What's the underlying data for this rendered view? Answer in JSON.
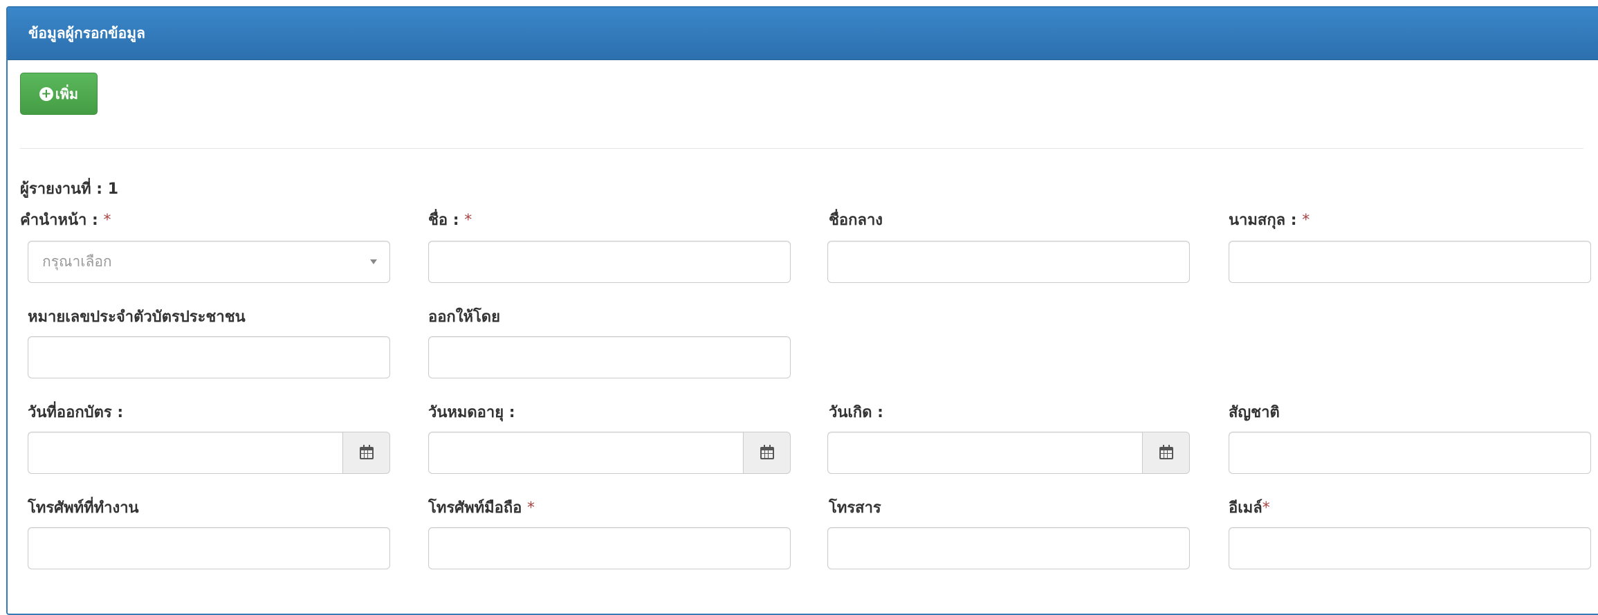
{
  "panel": {
    "title": "ข้อมูลผู้กรอกข้อมูล",
    "heading_color": "#337ab7"
  },
  "toolbar": {
    "add_label": "เพิ่ม",
    "add_icon": "plus-circle-icon",
    "add_color": "#5cb85c"
  },
  "reporter": {
    "section_label": "ผู้รายงานที่ : 1"
  },
  "form": {
    "title_prefix": {
      "label": "คำนำหน้า : ",
      "required": "*",
      "placeholder": "กรุณาเลือก"
    },
    "first_name": {
      "label": "ชื่อ : ",
      "required": "*",
      "value": ""
    },
    "middle_name": {
      "label": "ชื่อกลาง",
      "value": ""
    },
    "last_name": {
      "label": "นามสกุล : ",
      "required": "*",
      "value": ""
    },
    "id_card_number": {
      "label": "หมายเลขประจำตัวบัตรประชาชน",
      "value": ""
    },
    "issued_by": {
      "label": "ออกให้โดย",
      "value": ""
    },
    "issue_date": {
      "label": "วันที่ออกบัตร :",
      "value": ""
    },
    "expiry_date": {
      "label": "วันหมดอายุ :",
      "value": ""
    },
    "birth_date": {
      "label": "วันเกิด :",
      "value": ""
    },
    "nationality": {
      "label": "สัญชาติ",
      "value": ""
    },
    "office_phone": {
      "label": "โทรศัพท์ที่ทำงาน",
      "value": ""
    },
    "mobile_phone": {
      "label": "โทรศัพท์มือถือ ",
      "required": "*",
      "value": ""
    },
    "fax": {
      "label": "โทรสาร",
      "value": ""
    },
    "email": {
      "label": "อีเมล์",
      "required": "*",
      "value": ""
    }
  },
  "icons": {
    "calendar": "calendar-icon",
    "dropdown": "chevron-down-icon"
  }
}
